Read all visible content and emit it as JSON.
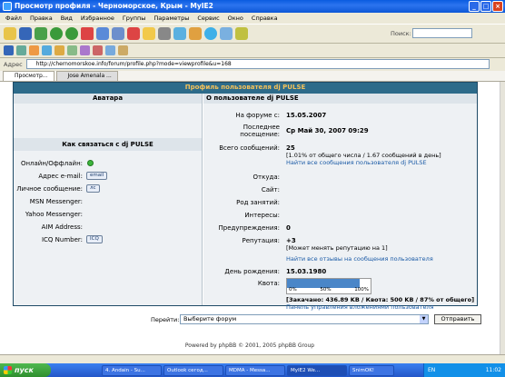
{
  "window": {
    "title": "Просмотр профиля - Черноморское, Крым - MyIE2"
  },
  "menu": [
    "Файл",
    "Правка",
    "Вид",
    "Избранное",
    "Группы",
    "Параметры",
    "Сервис",
    "Окно",
    "Справка"
  ],
  "search": {
    "label": "Поиск:"
  },
  "address": {
    "label": "Адрес",
    "url": "http://chernomorskoe.info/forum/profile.php?mode=viewprofile&u=168"
  },
  "tabs": [
    {
      "label": "Просмотр..."
    },
    {
      "label": "Jose Amenala ..."
    }
  ],
  "profile": {
    "panel_title": "Профиль пользователя dj PULSE",
    "avatar_heading": "Аватара",
    "about_heading": "О пользователе dj PULSE",
    "contact_heading": "Как связаться с dj PULSE",
    "contact": {
      "online_label": "Онлайн/Оффлайн:",
      "email_label": "Адрес e-mail:",
      "email_btn": "email",
      "pm_label": "Личное сообщение:",
      "pm_btn": "лс",
      "msn_label": "MSN Messenger:",
      "yahoo_label": "Yahoo Messenger:",
      "aim_label": "AIM Address:",
      "icq_label": "ICQ Number:",
      "icq_btn": "ICQ"
    },
    "about": {
      "joined_label": "На форуме с:",
      "joined_value": "15.05.2007",
      "last_visit_label_1": "Последнее",
      "last_visit_label_2": "посещение:",
      "last_visit_value": "Ср Май 30, 2007 09:29",
      "posts_label": "Всего сообщений:",
      "posts_value": "25",
      "posts_pct": "[1.01% от общего числа / 1.67 сообщений в день]",
      "posts_link": "Найти все сообщения пользователя dj PULSE",
      "from_label": "Откуда:",
      "site_label": "Сайт:",
      "occupation_label": "Род занятий:",
      "interests_label": "Интересы:",
      "warnings_label": "Предупреждения:",
      "warnings_value": "0",
      "rep_label": "Репутация:",
      "rep_value": "+3",
      "rep_note": "[Может менять репутацию на 1]",
      "rep_link": "Найти все отзывы на сообщения пользователя",
      "birthday_label": "День рождения:",
      "birthday_value": "15.03.1980",
      "quota_label": "Квота:",
      "quota_fraction": 0.87,
      "quota_ticks": [
        "0%",
        "50%",
        "100%"
      ],
      "quota_stats": "[Закачано: 436.89 KB / Квота: 500 KB / 87% от общего]",
      "attach_link": "Панель управления вложениями пользователя"
    }
  },
  "jump": {
    "label": "Перейти:",
    "selected": "Выберите форум",
    "button": "Отправить"
  },
  "footer": "Powered by phpBB © 2001, 2005 phpBB Group",
  "taskbar": {
    "start": "пуск",
    "items": [
      "4. Andain - Su...",
      "Outlook сегод...",
      "MDMA - Messa...",
      "MyIE2 We...",
      "SnimOK!"
    ],
    "lang": "EN",
    "time": "11:02"
  }
}
